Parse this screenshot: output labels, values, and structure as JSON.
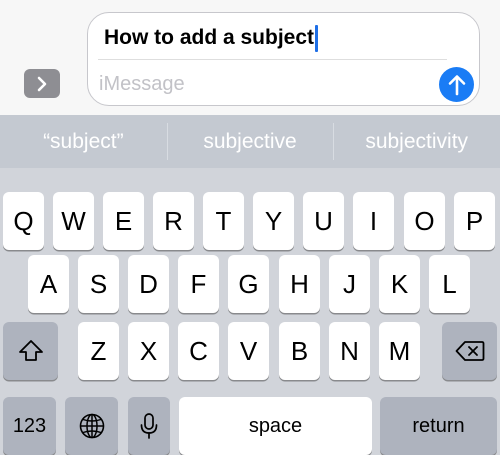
{
  "compose": {
    "subject_text": "How to add a subject",
    "message_placeholder": "iMessage"
  },
  "suggestions": [
    "“subject”",
    "subjective",
    "subjectivity"
  ],
  "keyboard": {
    "row1": [
      "Q",
      "W",
      "E",
      "R",
      "T",
      "Y",
      "U",
      "I",
      "O",
      "P"
    ],
    "row2": [
      "A",
      "S",
      "D",
      "F",
      "G",
      "H",
      "J",
      "K",
      "L"
    ],
    "row3": [
      "Z",
      "X",
      "C",
      "V",
      "B",
      "N",
      "M"
    ],
    "numbers_label": "123",
    "space_label": "space",
    "return_label": "return"
  },
  "colors": {
    "send_button": "#1a7cf5",
    "caret": "#1f6fe6",
    "special_key": "#aeb3be",
    "suggestion_bar": "#c4c9d1"
  },
  "icons": {
    "expand": "chevron-right-icon",
    "send": "arrow-up-icon",
    "shift": "shift-icon",
    "delete": "delete-backspace-icon",
    "globe": "globe-icon",
    "dictation": "microphone-icon"
  }
}
